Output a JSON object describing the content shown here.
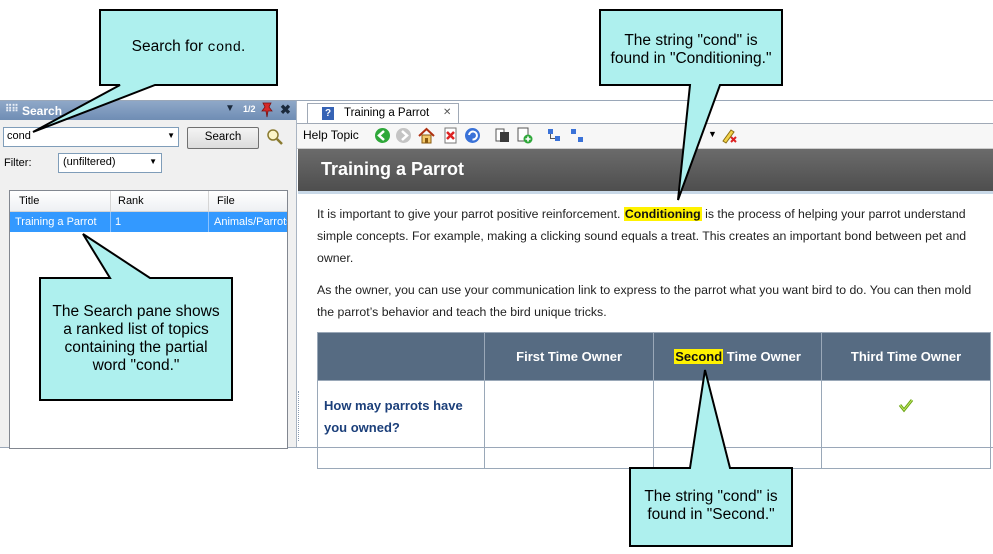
{
  "search_pane": {
    "title": "Search",
    "pager": "1/2",
    "query": "cond",
    "search_button": "Search",
    "filter_label": "Filter:",
    "filter_value": "(unfiltered)",
    "columns": [
      "Title",
      "Rank",
      "File"
    ],
    "results": [
      {
        "title": "Training a Parrot",
        "rank": "1",
        "file": "Animals/Parrots"
      }
    ]
  },
  "topic": {
    "tab_label": "Training a Parrot",
    "toolbar_label": "Help Topic",
    "heading": "Training a Parrot",
    "para1_pre": "It is important to give your parrot positive reinforcement. ",
    "para1_hl": "Conditioning",
    "para1_post": " is the process of helping your parrot understand simple concepts. For example, making a clicking sound equals a treat. This creates an important bond between pet and owner.",
    "para2": "As the owner, you can use your communication link to express to the parrot what you want bird to do. You can then mold the parrot’s behavior and teach the bird unique tricks.",
    "table": {
      "col1": "First Time Owner",
      "col2_hl": "Second",
      "col2_rest": " Time Owner",
      "col3": "Third Time Owner",
      "row_question": "How may parrots have you owned?"
    }
  },
  "callouts": {
    "top_left_prefix": "Search for ",
    "top_left_code": "cond",
    "top_left_suffix": ".",
    "top_right_line1": "The string \"cond\" is",
    "top_right_line2": "found in \"Conditioning.\"",
    "left_line1": "The Search pane shows",
    "left_line2": "a ranked list of topics",
    "left_line3": "containing the partial",
    "left_line4": "word \"cond.\"",
    "bottom_line1": "The string \"cond\" is",
    "bottom_line2": "found in \"Second.\""
  },
  "colors": {
    "callout_fill": "#aef0ee",
    "selection": "#3399ff",
    "highlight": "#fff200",
    "banner": "#5a5a5a",
    "table_header": "#566b82"
  }
}
